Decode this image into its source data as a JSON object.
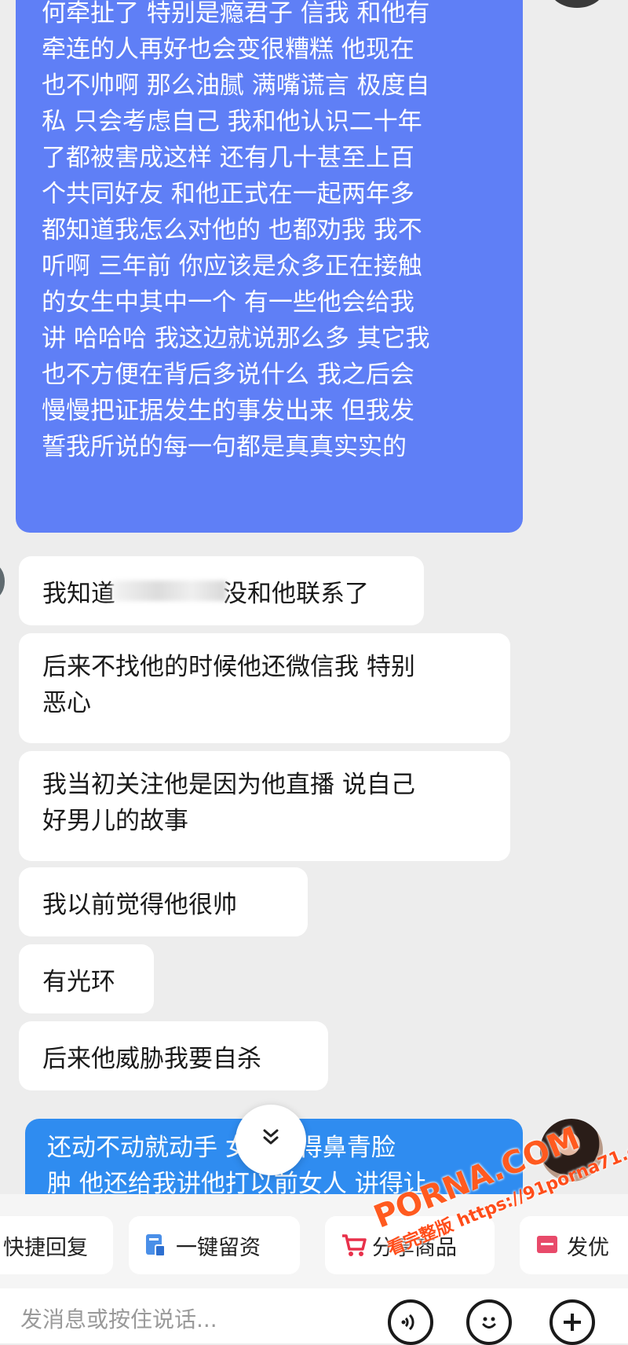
{
  "chat": {
    "outgoing_top_lines": [
      "何牵扯了 特别是瘾君子 信我 和他有",
      "牵连的人再好也会变很糟糕 他现在",
      "也不帅啊 那么油腻 满嘴谎言 极度自",
      "私 只会考虑自己 我和他认识二十年",
      "了都被害成这样 还有几十甚至上百",
      "个共同好友 和他正式在一起两年多",
      "都知道我怎么对他的 也都劝我 我不",
      "听啊 三年前 你应该是众多正在接触",
      "的女生中其中一个 有一些他会给我",
      "讲 哈哈哈 我这边就说那么多 其它我",
      "也不方便在背后多说什么 我之后会",
      "慢慢把证据发生的事发出来 但我发",
      "誓我所说的每一句都是真真实实的"
    ],
    "incoming": [
      {
        "pre": "我知道",
        "post": "没和他联系了"
      },
      {
        "lines": [
          "后来不找他的时候他还微信我 特别",
          "恶心"
        ]
      },
      {
        "lines": [
          "我当初关注他是因为他直播 说自己",
          "好男儿的故事"
        ]
      },
      {
        "text": "我以前觉得他很帅"
      },
      {
        "text": "有光环"
      },
      {
        "text": "后来他威胁我要自杀"
      }
    ],
    "outgoing_bottom_lines": [
      "还动不动就动手 女生打得鼻青脸",
      "肿 他还给我讲他打以前女人 讲得让"
    ]
  },
  "scroll_down_icon": "chevron-double-down-icon",
  "quick_actions": [
    {
      "label": "快捷回复",
      "icon": ""
    },
    {
      "label": "一键留资",
      "icon": "form-icon"
    },
    {
      "label": "分享商品",
      "icon": "cart-icon"
    },
    {
      "label": "发优",
      "icon": "coupon-icon"
    }
  ],
  "input": {
    "placeholder": "发消息或按住说话..."
  },
  "toolbar_icons": [
    "voice-icon",
    "emoji-icon",
    "plus-icon"
  ],
  "watermark": {
    "site": "PORNA.COM",
    "url": "https://91porna71.com",
    "label": "看完整版"
  },
  "colors": {
    "outgoing_top": "#5f7ff6",
    "outgoing_bottom": "#2f8cf0",
    "incoming": "#ffffff",
    "background": "#ededed"
  }
}
